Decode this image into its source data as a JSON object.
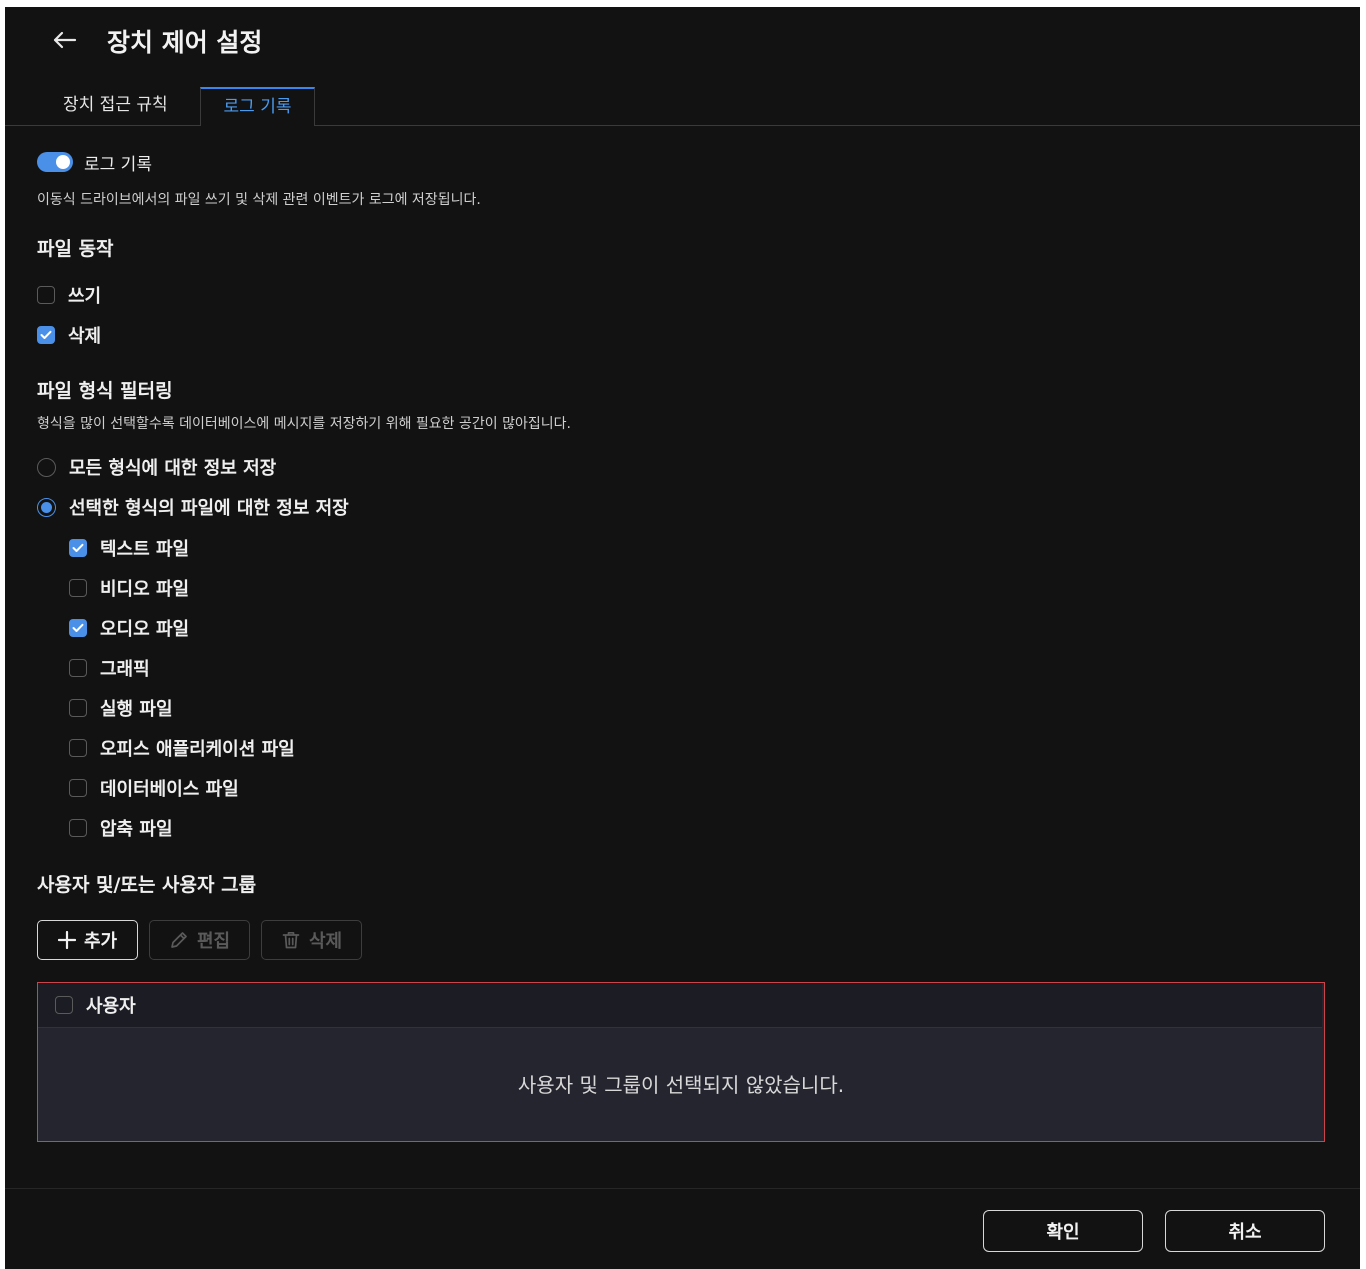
{
  "header": {
    "title": "장치 제어 설정"
  },
  "tabs": [
    {
      "label": "장치 접근 규칙",
      "active": false
    },
    {
      "label": "로그 기록",
      "active": true
    }
  ],
  "logging": {
    "toggle_label": "로그 기록",
    "toggle_on": true,
    "description": "이동식 드라이브에서의 파일 쓰기 및 삭제 관련 이벤트가 로그에 저장됩니다."
  },
  "file_ops": {
    "title": "파일 동작",
    "items": [
      {
        "label": "쓰기",
        "checked": false
      },
      {
        "label": "삭제",
        "checked": true
      }
    ]
  },
  "format_filter": {
    "title": "파일 형식 필터링",
    "description": "형식을 많이 선택할수록 데이터베이스에 메시지를 저장하기 위해 필요한 공간이 많아집니다.",
    "options": [
      {
        "label": "모든 형식에 대한 정보 저장",
        "selected": false
      },
      {
        "label": "선택한 형식의 파일에 대한 정보 저장",
        "selected": true
      }
    ],
    "types": [
      {
        "label": "텍스트 파일",
        "checked": true
      },
      {
        "label": "비디오 파일",
        "checked": false
      },
      {
        "label": "오디오 파일",
        "checked": true
      },
      {
        "label": "그래픽",
        "checked": false
      },
      {
        "label": "실행 파일",
        "checked": false
      },
      {
        "label": "오피스 애플리케이션 파일",
        "checked": false
      },
      {
        "label": "데이터베이스 파일",
        "checked": false
      },
      {
        "label": "압축 파일",
        "checked": false
      }
    ]
  },
  "users": {
    "title": "사용자 및/또는 사용자 그룹",
    "add_label": "추가",
    "edit_label": "편집",
    "delete_label": "삭제",
    "column_header": "사용자",
    "empty_message": "사용자 및 그룹이 선택되지 않았습니다."
  },
  "footer": {
    "ok_label": "확인",
    "cancel_label": "취소"
  },
  "colors": {
    "accent": "#4a90e8",
    "background": "#121212",
    "error_border": "#c9454b"
  }
}
